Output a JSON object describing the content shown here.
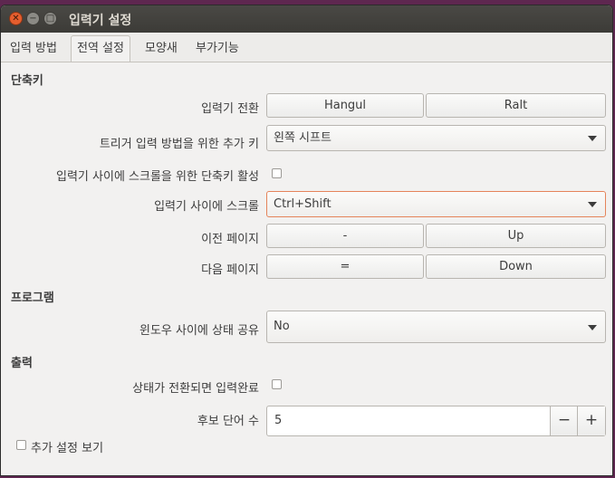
{
  "window": {
    "title": "입력기 설정"
  },
  "tabs": [
    {
      "label": "입력 방법"
    },
    {
      "label": "전역 설정"
    },
    {
      "label": "모양새"
    },
    {
      "label": "부가기능"
    }
  ],
  "shortcuts": {
    "header": "단축키",
    "toggle": {
      "label": "입력기 전환",
      "key1": "Hangul",
      "key2": "Ralt"
    },
    "extra_trigger": {
      "label": "트리거 입력 방법을 위한 추가 키",
      "value": "왼쪽 시프트"
    },
    "enable_scroll": {
      "label": "입력기 사이에 스크롤을 위한 단축키 활성"
    },
    "scroll": {
      "label": "입력기 사이에 스크롤",
      "value": "Ctrl+Shift"
    },
    "prev_page": {
      "label": "이전 페이지",
      "key1": "-",
      "key2": "Up"
    },
    "next_page": {
      "label": "다음 페이지",
      "key1": "=",
      "key2": "Down"
    }
  },
  "program": {
    "header": "프로그램",
    "share_state": {
      "label": "윈도우 사이에 상태 공유",
      "value": "No"
    }
  },
  "output": {
    "header": "출력",
    "commit_on_switch": {
      "label": "상태가 전환되면 입력완료"
    },
    "candidate_words": {
      "label": "후보 단어 수",
      "value": "5",
      "minus": "−",
      "plus": "+"
    }
  },
  "show_advanced": {
    "label": "추가 설정 보기"
  }
}
